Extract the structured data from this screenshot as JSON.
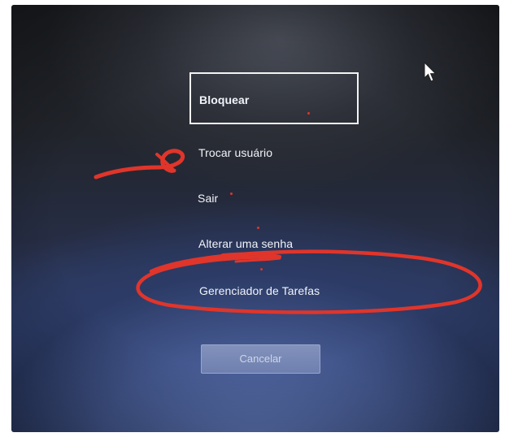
{
  "security_screen": {
    "menu": {
      "items": [
        {
          "id": "lock",
          "label": "Bloquear",
          "focused": true
        },
        {
          "id": "switch-user",
          "label": "Trocar usuário",
          "focused": false
        },
        {
          "id": "sign-out",
          "label": "Sair",
          "focused": false
        },
        {
          "id": "change-password",
          "label": "Alterar uma senha",
          "focused": false
        },
        {
          "id": "task-manager",
          "label": "Gerenciador de Tarefas",
          "focused": false
        }
      ]
    },
    "cancel_label": "Cancelar"
  },
  "annotations": {
    "color": "#e0352b",
    "marks": [
      "arrow-pointing-switch-user",
      "underline-change-password",
      "circle-task-manager"
    ]
  },
  "colors": {
    "text": "#f2f4fa",
    "focus_border": "#f4f4f4",
    "button_bg": "#7f8fbd",
    "background_top": "#1e2024",
    "background_bottom": "#4a62a4"
  },
  "icons": {
    "cursor": "mouse-pointer-icon"
  }
}
